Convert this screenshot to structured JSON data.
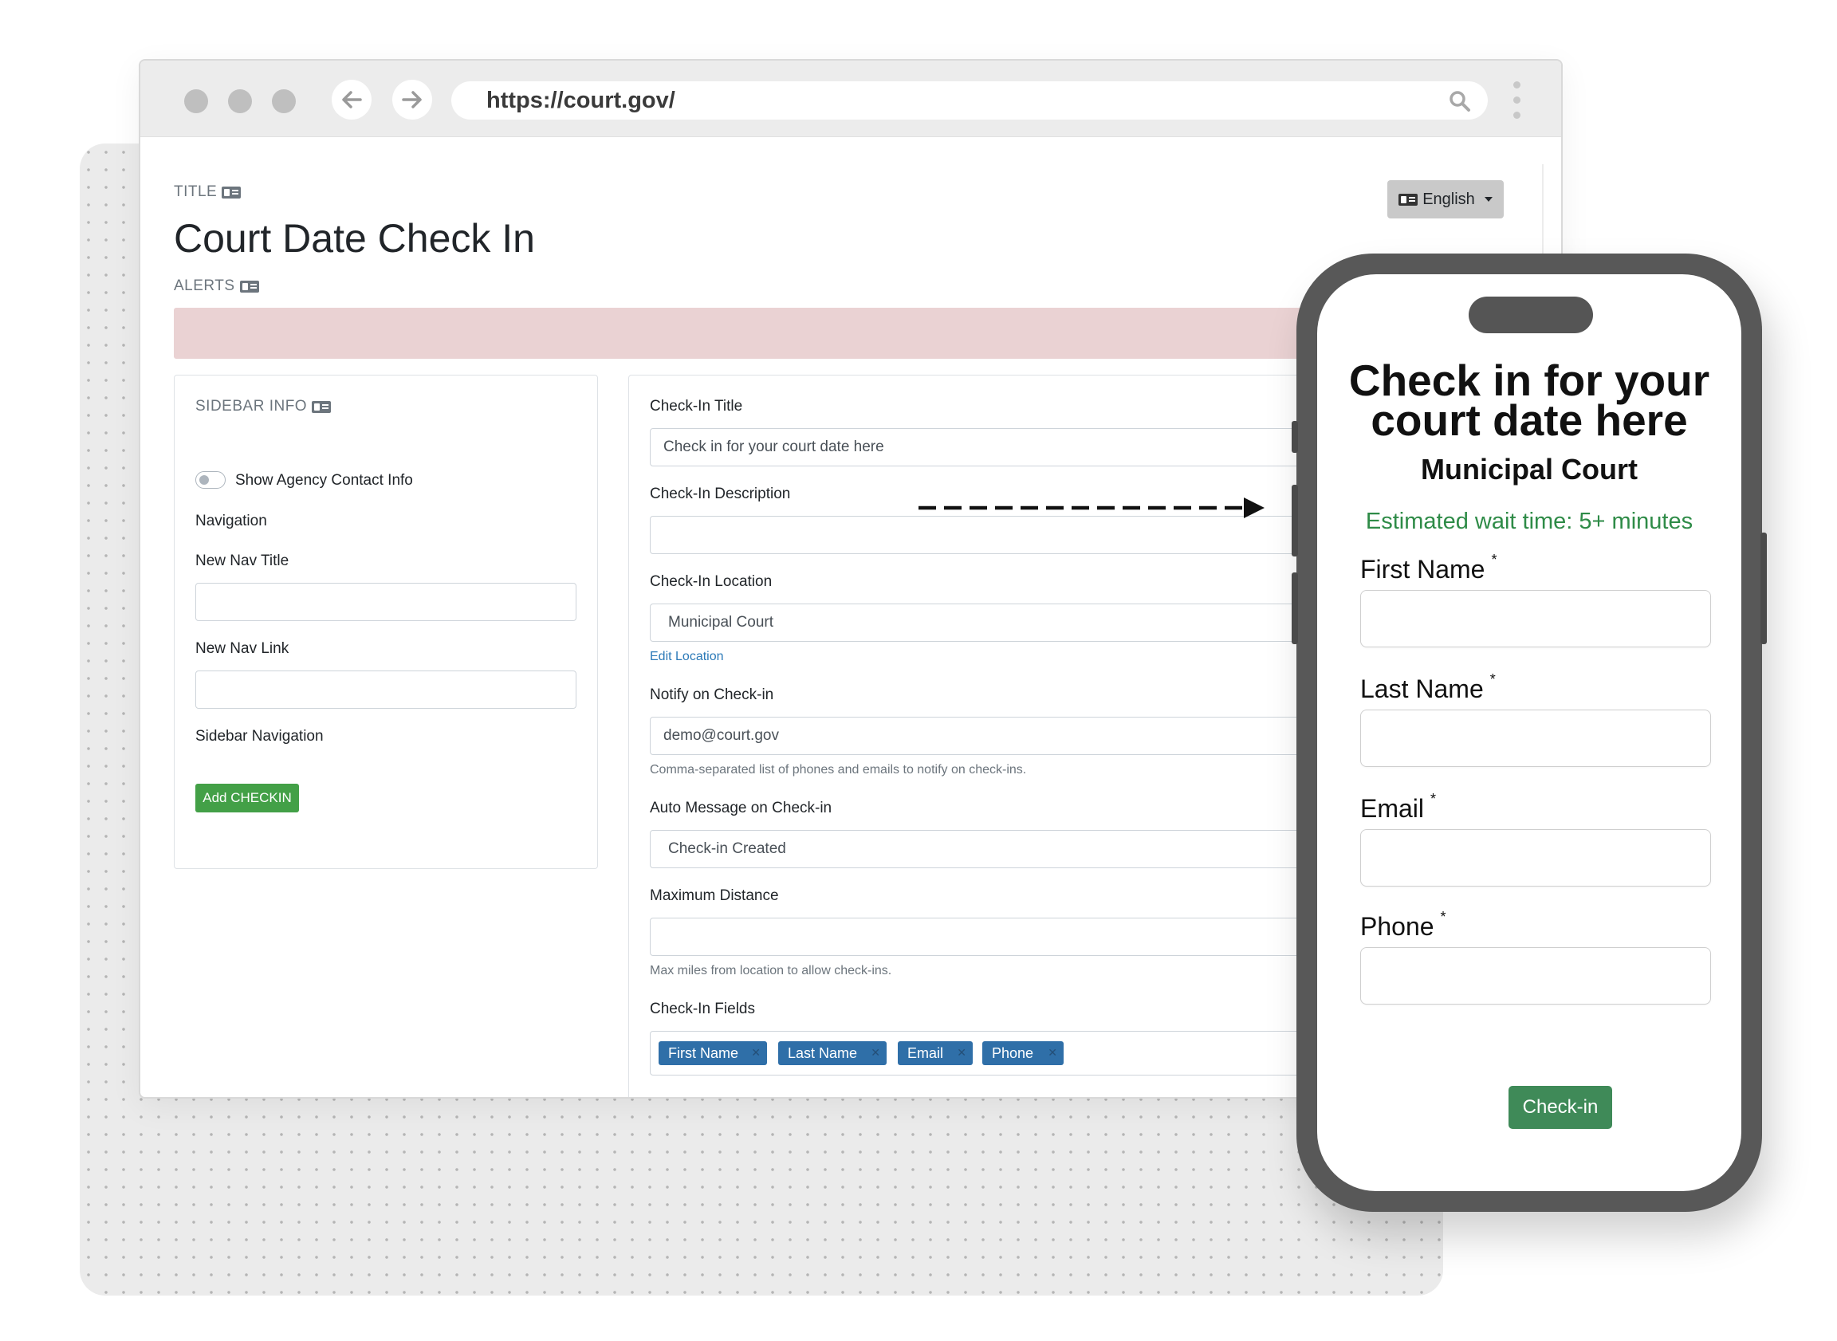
{
  "browser": {
    "url": "https://court.gov/",
    "icons": [
      "arrow-left-icon",
      "arrow-right-icon",
      "search-icon",
      "more-vertical-icon"
    ]
  },
  "page": {
    "title_label": "TITLE",
    "title": "Court Date Check In",
    "alerts_label": "ALERTS",
    "language": "English"
  },
  "sidebar": {
    "label": "SIDEBAR INFO",
    "toggle_label": "Show Agency Contact Info",
    "navigation": "Navigation",
    "new_nav_title": "New Nav Title",
    "new_nav_link": "New Nav Link",
    "sidebar_navigation": "Sidebar Navigation",
    "add_button": "Add CHECKIN"
  },
  "form": {
    "checkin_title_label": "Check-In Title",
    "checkin_title_value": "Check in for your court date here",
    "description_label": "Check-In Description",
    "location_label": "Check-In Location",
    "location_value": "Municipal Court",
    "edit_location": "Edit Location",
    "notify_label": "Notify on Check-in",
    "notify_value": "demo@court.gov",
    "notify_help": "Comma-separated list of phones and emails to notify on check-ins.",
    "auto_message_label": "Auto Message on Check-in",
    "auto_message_value": "Check-in Created",
    "max_distance_label": "Maximum Distance",
    "max_distance_help": "Max miles from location to allow check-ins.",
    "fields_label": "Check-In Fields",
    "fields": [
      "First Name",
      "Last Name",
      "Email",
      "Phone"
    ]
  },
  "phone": {
    "title_line1": "Check in for your",
    "title_line2": "court date here",
    "subtitle": "Municipal Court",
    "wait": "Estimated wait time: 5+ minutes",
    "fields": [
      "First Name",
      "Last Name",
      "Email",
      "Phone"
    ],
    "required_mark": "*",
    "button": "Check-in"
  },
  "colors": {
    "accent_green": "#43a047",
    "tag_blue": "#2f6fa8",
    "alert_bg": "#ead2d3",
    "wait_green": "#2e8b47"
  }
}
